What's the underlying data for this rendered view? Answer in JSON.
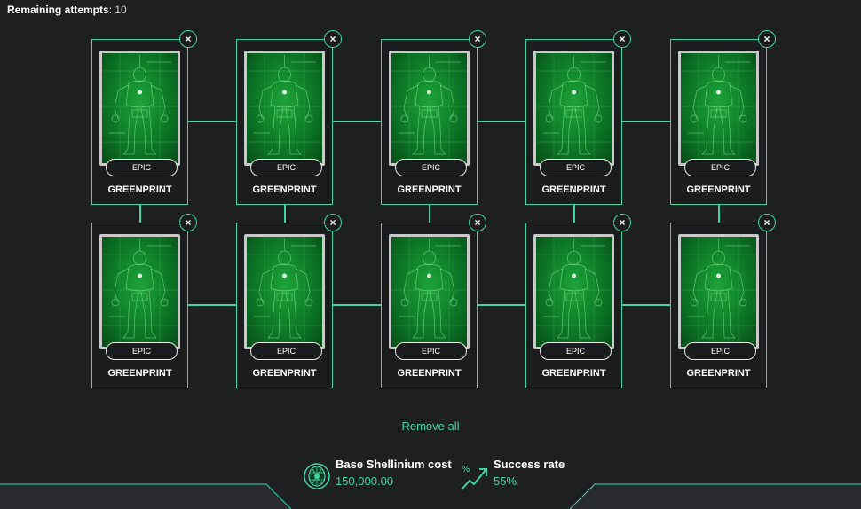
{
  "header": {
    "attempts_label": "Remaining attempts",
    "attempts_value": "10"
  },
  "cards": [
    {
      "rarity": "EPIC",
      "name": "GREENPRINT"
    },
    {
      "rarity": "EPIC",
      "name": "GREENPRINT"
    },
    {
      "rarity": "EPIC",
      "name": "GREENPRINT"
    },
    {
      "rarity": "EPIC",
      "name": "GREENPRINT"
    },
    {
      "rarity": "EPIC",
      "name": "GREENPRINT"
    },
    {
      "rarity": "EPIC",
      "name": "GREENPRINT"
    },
    {
      "rarity": "EPIC",
      "name": "GREENPRINT"
    },
    {
      "rarity": "EPIC",
      "name": "GREENPRINT"
    },
    {
      "rarity": "EPIC",
      "name": "GREENPRINT"
    },
    {
      "rarity": "EPIC",
      "name": "GREENPRINT"
    }
  ],
  "actions": {
    "remove_all": "Remove all",
    "close_glyph": "×"
  },
  "stats": {
    "cost_label": "Base Shellinium cost",
    "cost_value": "150,000.00",
    "rate_label": "Success rate",
    "rate_value": "55%"
  },
  "colors": {
    "accent": "#3fd4a3",
    "background": "#1e1f21",
    "card_art": "#118a2c"
  }
}
